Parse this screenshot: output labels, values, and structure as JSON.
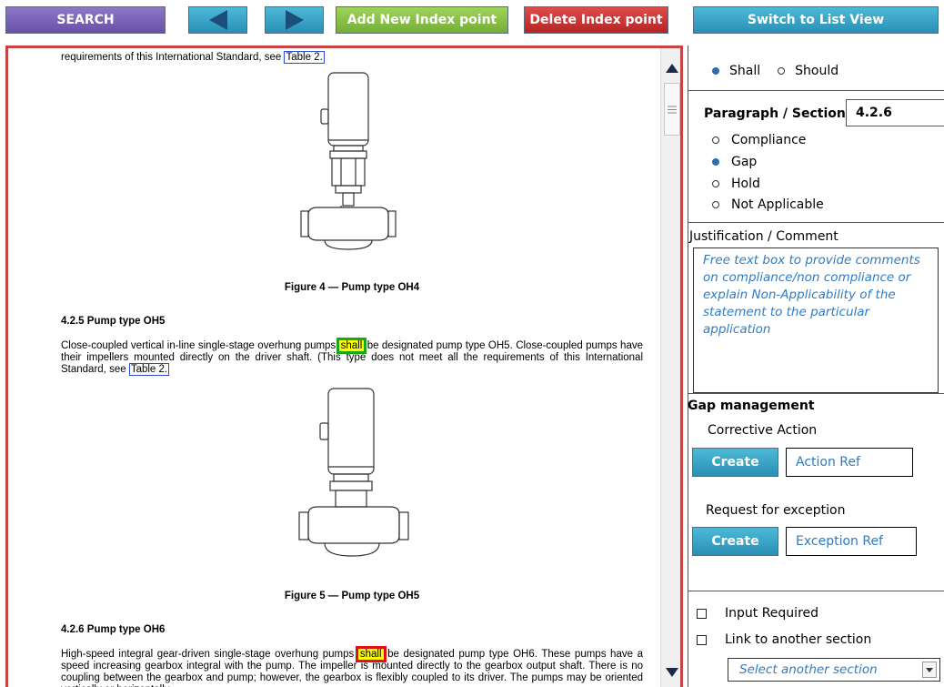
{
  "toolbar": {
    "search_label": "SEARCH",
    "add_label": "Add New Index point",
    "delete_label": "Delete Index point",
    "switch_label": "Switch to List View"
  },
  "document": {
    "line_top": "requirements of this International Standard, see",
    "table_ref": "Table 2.",
    "fig4_caption": "Figure 4 — Pump type OH4",
    "sec425_heading": "4.2.5   Pump type OH5",
    "p425_before": "Close-coupled vertical in-line single-stage overhung pumps",
    "p425_keyword": "shall",
    "p425_after": "be designated pump type OH5. Close-coupled pumps have their impellers mounted directly on the driver shaft. (This type does not meet all the requirements of this International Standard, see",
    "fig5_caption": "Figure 5 — Pump type OH5",
    "sec426_heading": "4.2.6   Pump type OH6",
    "p426_before": "High-speed integral gear-driven single-stage overhung pumps",
    "p426_keyword": "shall",
    "p426_after": "be designated pump type OH6. These pumps have a speed increasing gearbox integral with the pump. The impeller is mounted directly to the gearbox output shaft. There is no coupling between the gearbox and pump; however, the gearbox is flexibly coupled to its driver. The pumps may be oriented vertically or horizontally."
  },
  "panel": {
    "shall_label": "Shall",
    "should_label": "Should",
    "paragraph_label": "Paragraph / Section",
    "paragraph_value": "4.2.6",
    "status_options": [
      "Compliance",
      "Gap",
      "Hold",
      "Not Applicable"
    ],
    "status_selected": "Gap",
    "justification_label": "Justification / Comment",
    "justification_placeholder": "Free text box to provide comments on compliance/non compliance or explain Non-Applicability of the statement to the particular application",
    "gap_management_label": "Gap management",
    "corrective_action_label": "Corrective Action",
    "create_label": "Create",
    "action_ref": "Action Ref",
    "request_exception_label": "Request for exception",
    "exception_ref": "Exception Ref",
    "input_required_label": "Input Required",
    "link_section_label": "Link to another section",
    "select_section_placeholder": "Select another section"
  },
  "colors": {
    "search": "#7a62b8",
    "nav": "#35a3c8",
    "add": "#86c043",
    "delete": "#c83232",
    "frame_border": "#c74444",
    "highlight": "#ffff00",
    "highlight_green": "#1aa81a",
    "highlight_red": "#e01010",
    "placeholder_text": "#2e7bc4"
  },
  "icons": [
    "arrow-left-icon",
    "arrow-right-icon",
    "scroll-up-icon",
    "scroll-down-icon",
    "dropdown-chevron-icon"
  ]
}
